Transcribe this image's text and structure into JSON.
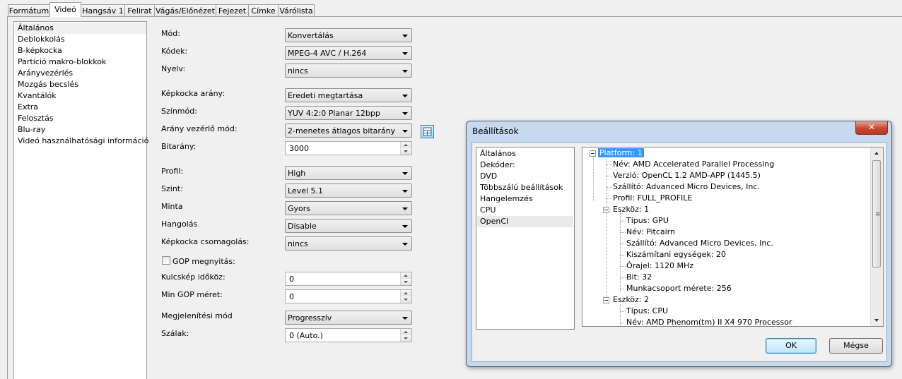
{
  "tabs": [
    {
      "label": "Formátum"
    },
    {
      "label": "Videó",
      "active": true
    },
    {
      "label": "Hangsáv 1"
    },
    {
      "label": "Felirat"
    },
    {
      "label": "Vágás/Előnézet"
    },
    {
      "label": "Fejezet"
    },
    {
      "label": "Címke"
    },
    {
      "label": "Várólista"
    }
  ],
  "categories": [
    "Általános",
    "Deblokkolás",
    "B-képkocka",
    "Partíció makro-blokkok",
    "Arányvezérlés",
    "Mozgás becslés",
    "Kvantálók",
    "Extra",
    "Felosztás",
    "Blu-ray",
    "Videó használhatósági információ"
  ],
  "form": {
    "mode_label": "Mód:",
    "mode_value": "Konvertálás",
    "codec_label": "Kódek:",
    "codec_value": "MPEG-4 AVC / H.264",
    "lang_label": "Nyelv:",
    "lang_value": "nincs",
    "aspect_label": "Képkocka arány:",
    "aspect_value": "Eredeti megtartása",
    "color_label": "Színmód:",
    "color_value": "YUV 4:2:0 Planar 12bpp",
    "rc_label": "Arány vezérlő mód:",
    "rc_value": "2-menetes átlagos bitarány",
    "bitrate_label": "Bitarány:",
    "bitrate_value": "3000",
    "profile_label": "Profil:",
    "profile_value": "High",
    "level_label": "Szint:",
    "level_value": "Level 5.1",
    "preset_label": "Minta",
    "preset_value": "Gyors",
    "tune_label": "Hangolás",
    "tune_value": "Disable",
    "packing_label": "Képkocka csomagolás:",
    "packing_value": "nincs",
    "gop_label": "GOP megnyitás:",
    "gop_checked": false,
    "keyint_label": "Kulcskép időköz:",
    "keyint_value": "0",
    "mingop_label": "Min GOP méret:",
    "mingop_value": "0",
    "display_label": "Megjelenítési mód",
    "display_value": "Progresszív",
    "threads_label": "Szálak:",
    "threads_value": "0 (Auto.)"
  },
  "dialog": {
    "title": "Beállítások",
    "close_glyph": "✕",
    "list": [
      "Általános",
      "Dekóder:",
      "DVD",
      "Többszálú beállítások",
      "Hangelemzés",
      "CPU",
      "OpenCl"
    ],
    "selected": "OpenCl",
    "tree": {
      "platform": "Platform: 1",
      "p_name": "Név: AMD Accelerated Parallel Processing",
      "p_version": "Verzió: OpenCL 1.2 AMD-APP (1445.5)",
      "p_vendor": "Szállító: Advanced Micro Devices, Inc.",
      "p_profile": "Profil: FULL_PROFILE",
      "dev1": "Eszköz: 1",
      "d1_type": "Típus: GPU",
      "d1_name": "Név: Pitcairn",
      "d1_vendor": "Szállító: Advanced Micro Devices, Inc.",
      "d1_units": "Kiszámítani egységek: 20",
      "d1_clock": "Órajel: 1120 MHz",
      "d1_bits": "Bit: 32",
      "d1_wg": "Munkacsoport mérete: 256",
      "dev2": "Eszköz: 2",
      "d2_type": "Típus: CPU",
      "d2_name": "Név: AMD Phenom(tm) II X4 970 Processor"
    },
    "ok": "OK",
    "cancel": "Mégse"
  }
}
